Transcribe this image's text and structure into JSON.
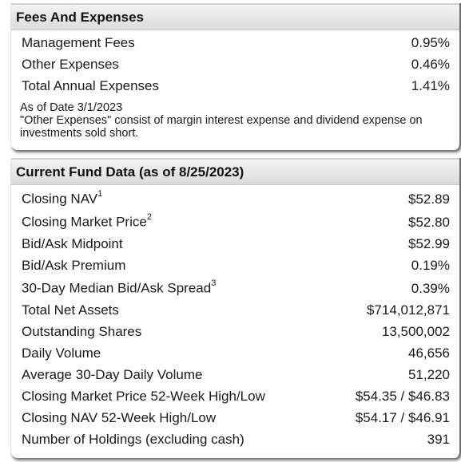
{
  "fees_panel": {
    "title": "Fees And Expenses",
    "rows": [
      {
        "label": "Management Fees",
        "value": "0.95%"
      },
      {
        "label": "Other Expenses",
        "value": "0.46%"
      },
      {
        "label": "Total Annual Expenses",
        "value": "1.41%"
      }
    ],
    "as_of": "As of Date 3/1/2023",
    "footnote": "\"Other Expenses\" consist of margin interest expense and dividend expense on investments sold short."
  },
  "fund_panel": {
    "title": "Current Fund Data (as of 8/25/2023)",
    "rows": [
      {
        "label": "Closing NAV",
        "sup": "1",
        "value": "$52.89"
      },
      {
        "label": "Closing Market Price",
        "sup": "2",
        "value": "$52.80"
      },
      {
        "label": "Bid/Ask Midpoint",
        "sup": "",
        "value": "$52.99"
      },
      {
        "label": "Bid/Ask Premium",
        "sup": "",
        "value": "0.19%"
      },
      {
        "label": "30-Day Median Bid/Ask Spread",
        "sup": "3",
        "value": "0.39%"
      },
      {
        "label": "Total Net Assets",
        "sup": "",
        "value": "$714,012,871"
      },
      {
        "label": "Outstanding Shares",
        "sup": "",
        "value": "13,500,002"
      },
      {
        "label": "Daily Volume",
        "sup": "",
        "value": "46,656"
      },
      {
        "label": "Average 30-Day Daily Volume",
        "sup": "",
        "value": "51,220"
      },
      {
        "label": "Closing Market Price 52-Week High/Low",
        "sup": "",
        "value": "$54.35 / $46.83"
      },
      {
        "label": "Closing NAV 52-Week High/Low",
        "sup": "",
        "value": "$54.17 / $46.91"
      },
      {
        "label": "Number of Holdings (excluding cash)",
        "sup": "",
        "value": "391"
      }
    ]
  }
}
